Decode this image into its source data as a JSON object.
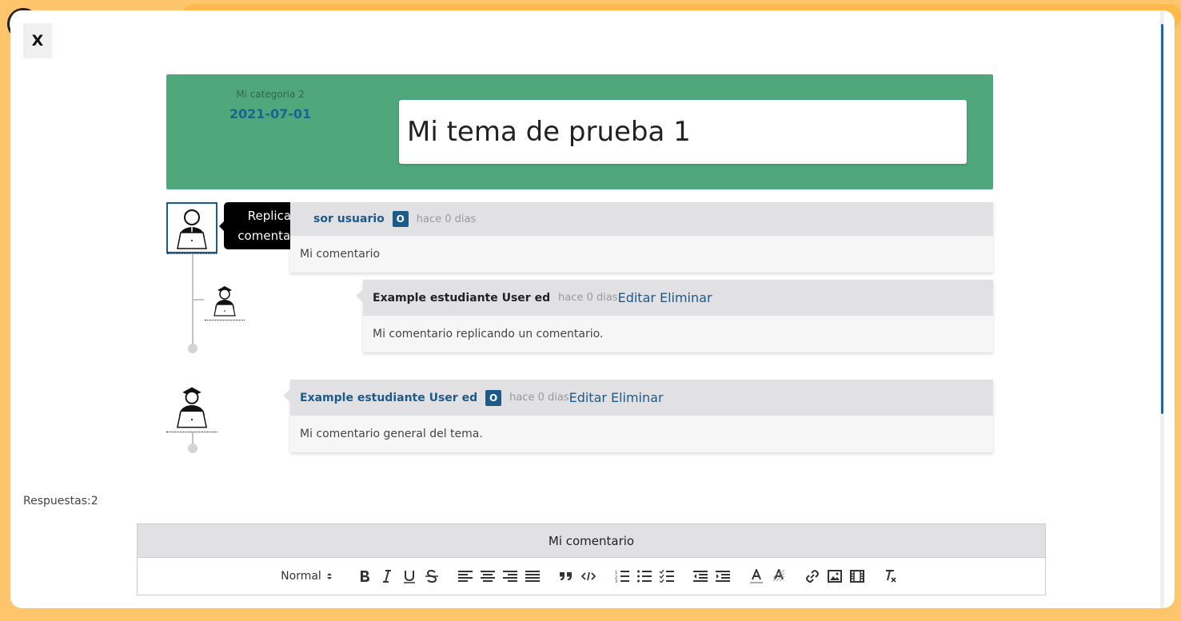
{
  "modal": {
    "close_label": "X"
  },
  "topic": {
    "category": "Mi categoria 2",
    "date": "2021-07-01",
    "title": "Mi tema de prueba 1"
  },
  "tooltip": {
    "text": "Replicar comentario"
  },
  "comments": [
    {
      "author": "Profesor usuario",
      "author_visible": "sor usuario",
      "role_badge": "O",
      "time": "hace 0 dias",
      "text": "Mi comentario",
      "replies": [
        {
          "author": "Example estudiante User ed",
          "time": "hace 0 dias",
          "actions": [
            "Editar",
            "Eliminar"
          ],
          "text": "Mi comentario replicando un comentario."
        }
      ]
    },
    {
      "author": "Example estudiante User ed",
      "role_badge": "O",
      "time": "hace 0 dias",
      "actions": [
        "Editar",
        "Eliminar"
      ],
      "text": "Mi comentario general del tema."
    }
  ],
  "answers": {
    "label": "Respuestas:2"
  },
  "editor": {
    "title": "Mi comentario",
    "format_select": "Normal",
    "toolbar_icons": [
      "bold-icon",
      "italic-icon",
      "underline-icon",
      "strike-icon",
      "align-left-icon",
      "align-center-icon",
      "align-right-icon",
      "align-justify-icon",
      "blockquote-icon",
      "code-icon",
      "ordered-list-icon",
      "bullet-list-icon",
      "check-list-icon",
      "outdent-icon",
      "indent-icon",
      "text-color-icon",
      "background-color-icon",
      "link-icon",
      "image-icon",
      "video-icon",
      "clear-format-icon"
    ]
  },
  "colors": {
    "background": "#ffc56d",
    "header": "#4fa77b",
    "accent": "#1c5a8a",
    "comment_head": "#e1e1e3",
    "comment_body": "#f6f6f6"
  }
}
